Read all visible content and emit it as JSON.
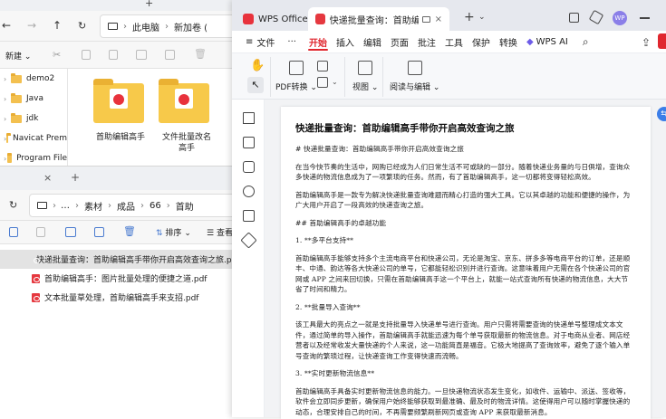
{
  "explorer1": {
    "nav": {
      "back": "←",
      "forward": "→",
      "up": "↑"
    },
    "breadcrumb": [
      "此电脑",
      "新加卷 ("
    ],
    "toolbar": {
      "new_label": "新建",
      "new_chevron": "⌄"
    },
    "nav_items": [
      {
        "label": "demo2"
      },
      {
        "label": "Java"
      },
      {
        "label": "jdk"
      },
      {
        "label": "Navicat Prem"
      },
      {
        "label": "Program File"
      }
    ],
    "folders": [
      {
        "label": "首助编辑高手"
      },
      {
        "label": "文件批量改名高手"
      }
    ]
  },
  "explorer2": {
    "tab_add": "+",
    "tab_close": "×",
    "breadcrumb": [
      "…",
      "素材",
      "成品",
      "66",
      "首助"
    ],
    "sort_label": "排序",
    "view_label": "查看",
    "files": [
      {
        "name": "快递批量查询：首助编辑高手带你开启高效查询之旅.pdf",
        "selected": true
      },
      {
        "name": "首助编辑高手：图片批量处理的便捷之道.pdf",
        "selected": false
      },
      {
        "name": "文本批量草处理，首助编辑高手来支招.pdf",
        "selected": false
      }
    ]
  },
  "wps": {
    "tabs": [
      {
        "label": "WPS Office"
      },
      {
        "label": "快递批量查询：首助编辑高手"
      }
    ],
    "tab_add": "+",
    "avatar_text": "WP",
    "menus": {
      "file": "文件",
      "more": "···",
      "items": [
        "开始",
        "插入",
        "编辑",
        "页面",
        "批注",
        "工具",
        "保护",
        "转换"
      ],
      "active": "开始",
      "wps_ai": "WPS AI"
    },
    "ribbon": {
      "pdf_convert": "PDF转换",
      "view": "视图",
      "read_edit": "阅读与编辑"
    },
    "document": {
      "title": "快递批量查询：首助编辑高手带你开启高效查询之旅",
      "paragraphs": [
        "# 快递批量查询：首助编辑高手带你开启高效查询之旅",
        "在当今快节奏的生活中，网购已经成为人们日常生活不可或缺的一部分。随着快递业务量的与日俱增，查询众多快递的物流信息成为了一项繁琐的任务。然而，有了首助编辑高手，这一切都将变得轻松高效。",
        "首助编辑高手是一款专为解决快递批量查询难题而精心打造的强大工具。它以其卓越的功能和便捷的操作，为广大用户开启了一段高效的快递查询之旅。",
        "## 首助编辑高手的卓越功能",
        "1. **多平台支持**",
        "首助编辑高手能够支持多个主流电商平台和快递公司，无论是淘宝、京东、拼多多等电商平台的订单，还是顺丰、中通、韵达等各大快递公司的单号，它都能轻松识别并进行查询。这意味着用户无需在各个快递公司的官网或 APP 之间来回切换，只需在首助编辑高手这一个平台上，就能一站式查询所有快递的物流信息，大大节省了时间和精力。",
        "2. **批量导入查询**",
        "该工具最大的亮点之一就是支持批量导入快递单号进行查询。用户只需将需要查询的快递单号整理成文本文件，通过简单的导入操作，首助编辑高手就能迅速为每个单号获取最新的物流信息。对于电商从业者、网店经营者以及经常收发大量快递的个人来说，这一功能简直是福音。它极大地提高了查询效率，避免了逐个输入单号查询的繁琐过程，让快递查询工作变得快速而流畅。",
        "3. **实时更新物流信息**",
        "首助编辑高手具备实时更新物流信息的能力。一旦快递物流状态发生变化，如收件、运输中、派送、签收等，软件会立即同步更新，确保用户始终能够获取到最准确、最及时的物流详情。这使得用户可以随时掌握快递的动态，合理安排自己的时间，不再需要频繁刷新网页或查询 APP 来获取最新消息。"
      ]
    }
  }
}
